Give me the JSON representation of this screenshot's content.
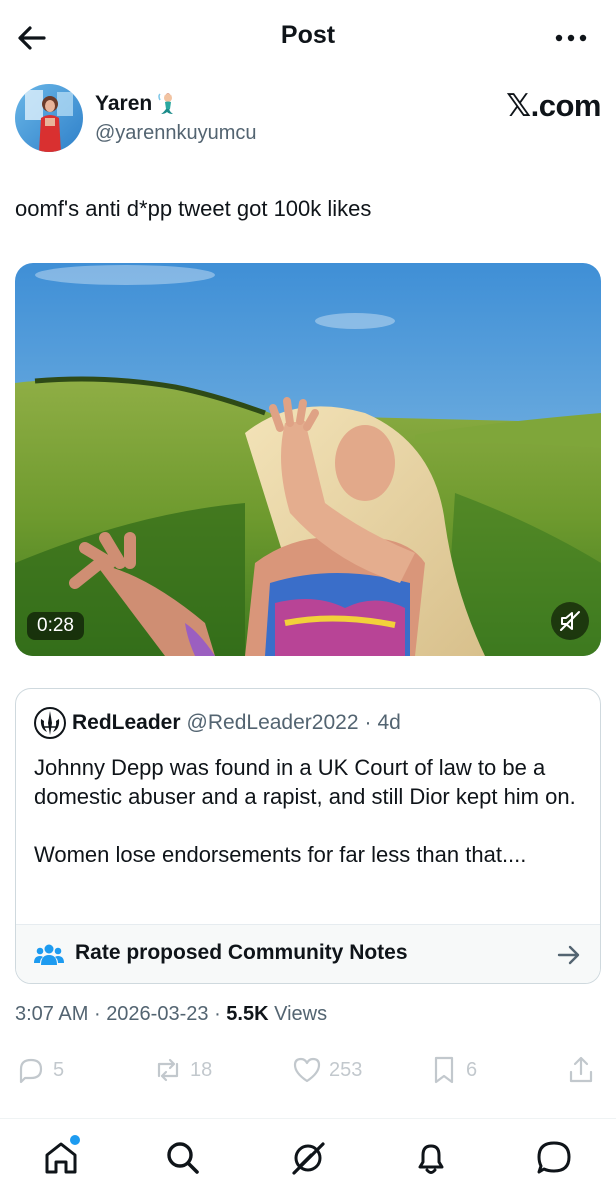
{
  "header": {
    "title": "Post",
    "back_icon": "arrow-left-icon",
    "more_icon": "more-horizontal-icon"
  },
  "post": {
    "author_name": "Yaren",
    "author_badge_icon": "mermaid-emoji-icon",
    "author_handle": "@yarennkuyumcu",
    "watermark": "𝕏.com",
    "text": "oomf's anti d*pp tweet got 100k likes",
    "video": {
      "duration": "0:28",
      "mute_icon": "muted-speaker-icon"
    },
    "quote": {
      "name": "RedLeader",
      "handle": "@RedLeader2022",
      "separator": "·",
      "time": "4d",
      "paragraph1": "Johnny Depp was found in a UK Court of law to be a domestic abuser and a rapist, and still Dior kept him on.",
      "paragraph2": "Women lose endorsements for far less than that....",
      "notes_label": "Rate proposed Community Notes",
      "notes_icon": "people-icon",
      "notes_arrow_icon": "arrow-right-icon"
    },
    "meta": {
      "time": "3:07 AM",
      "date": "2026-03-23",
      "views_count": "5.5K",
      "views_label": "Views",
      "sep": "·"
    },
    "actions": {
      "replies": "5",
      "reposts": "18",
      "likes": "253",
      "bookmarks": "6"
    }
  },
  "tabbar": {
    "tabs": [
      "home-icon",
      "search-icon",
      "grok-icon",
      "bell-icon",
      "messages-icon"
    ]
  },
  "colors": {
    "text": "#0f1419",
    "secondary": "#536471",
    "accent": "#1d9bf0",
    "border": "#cfd9de"
  }
}
